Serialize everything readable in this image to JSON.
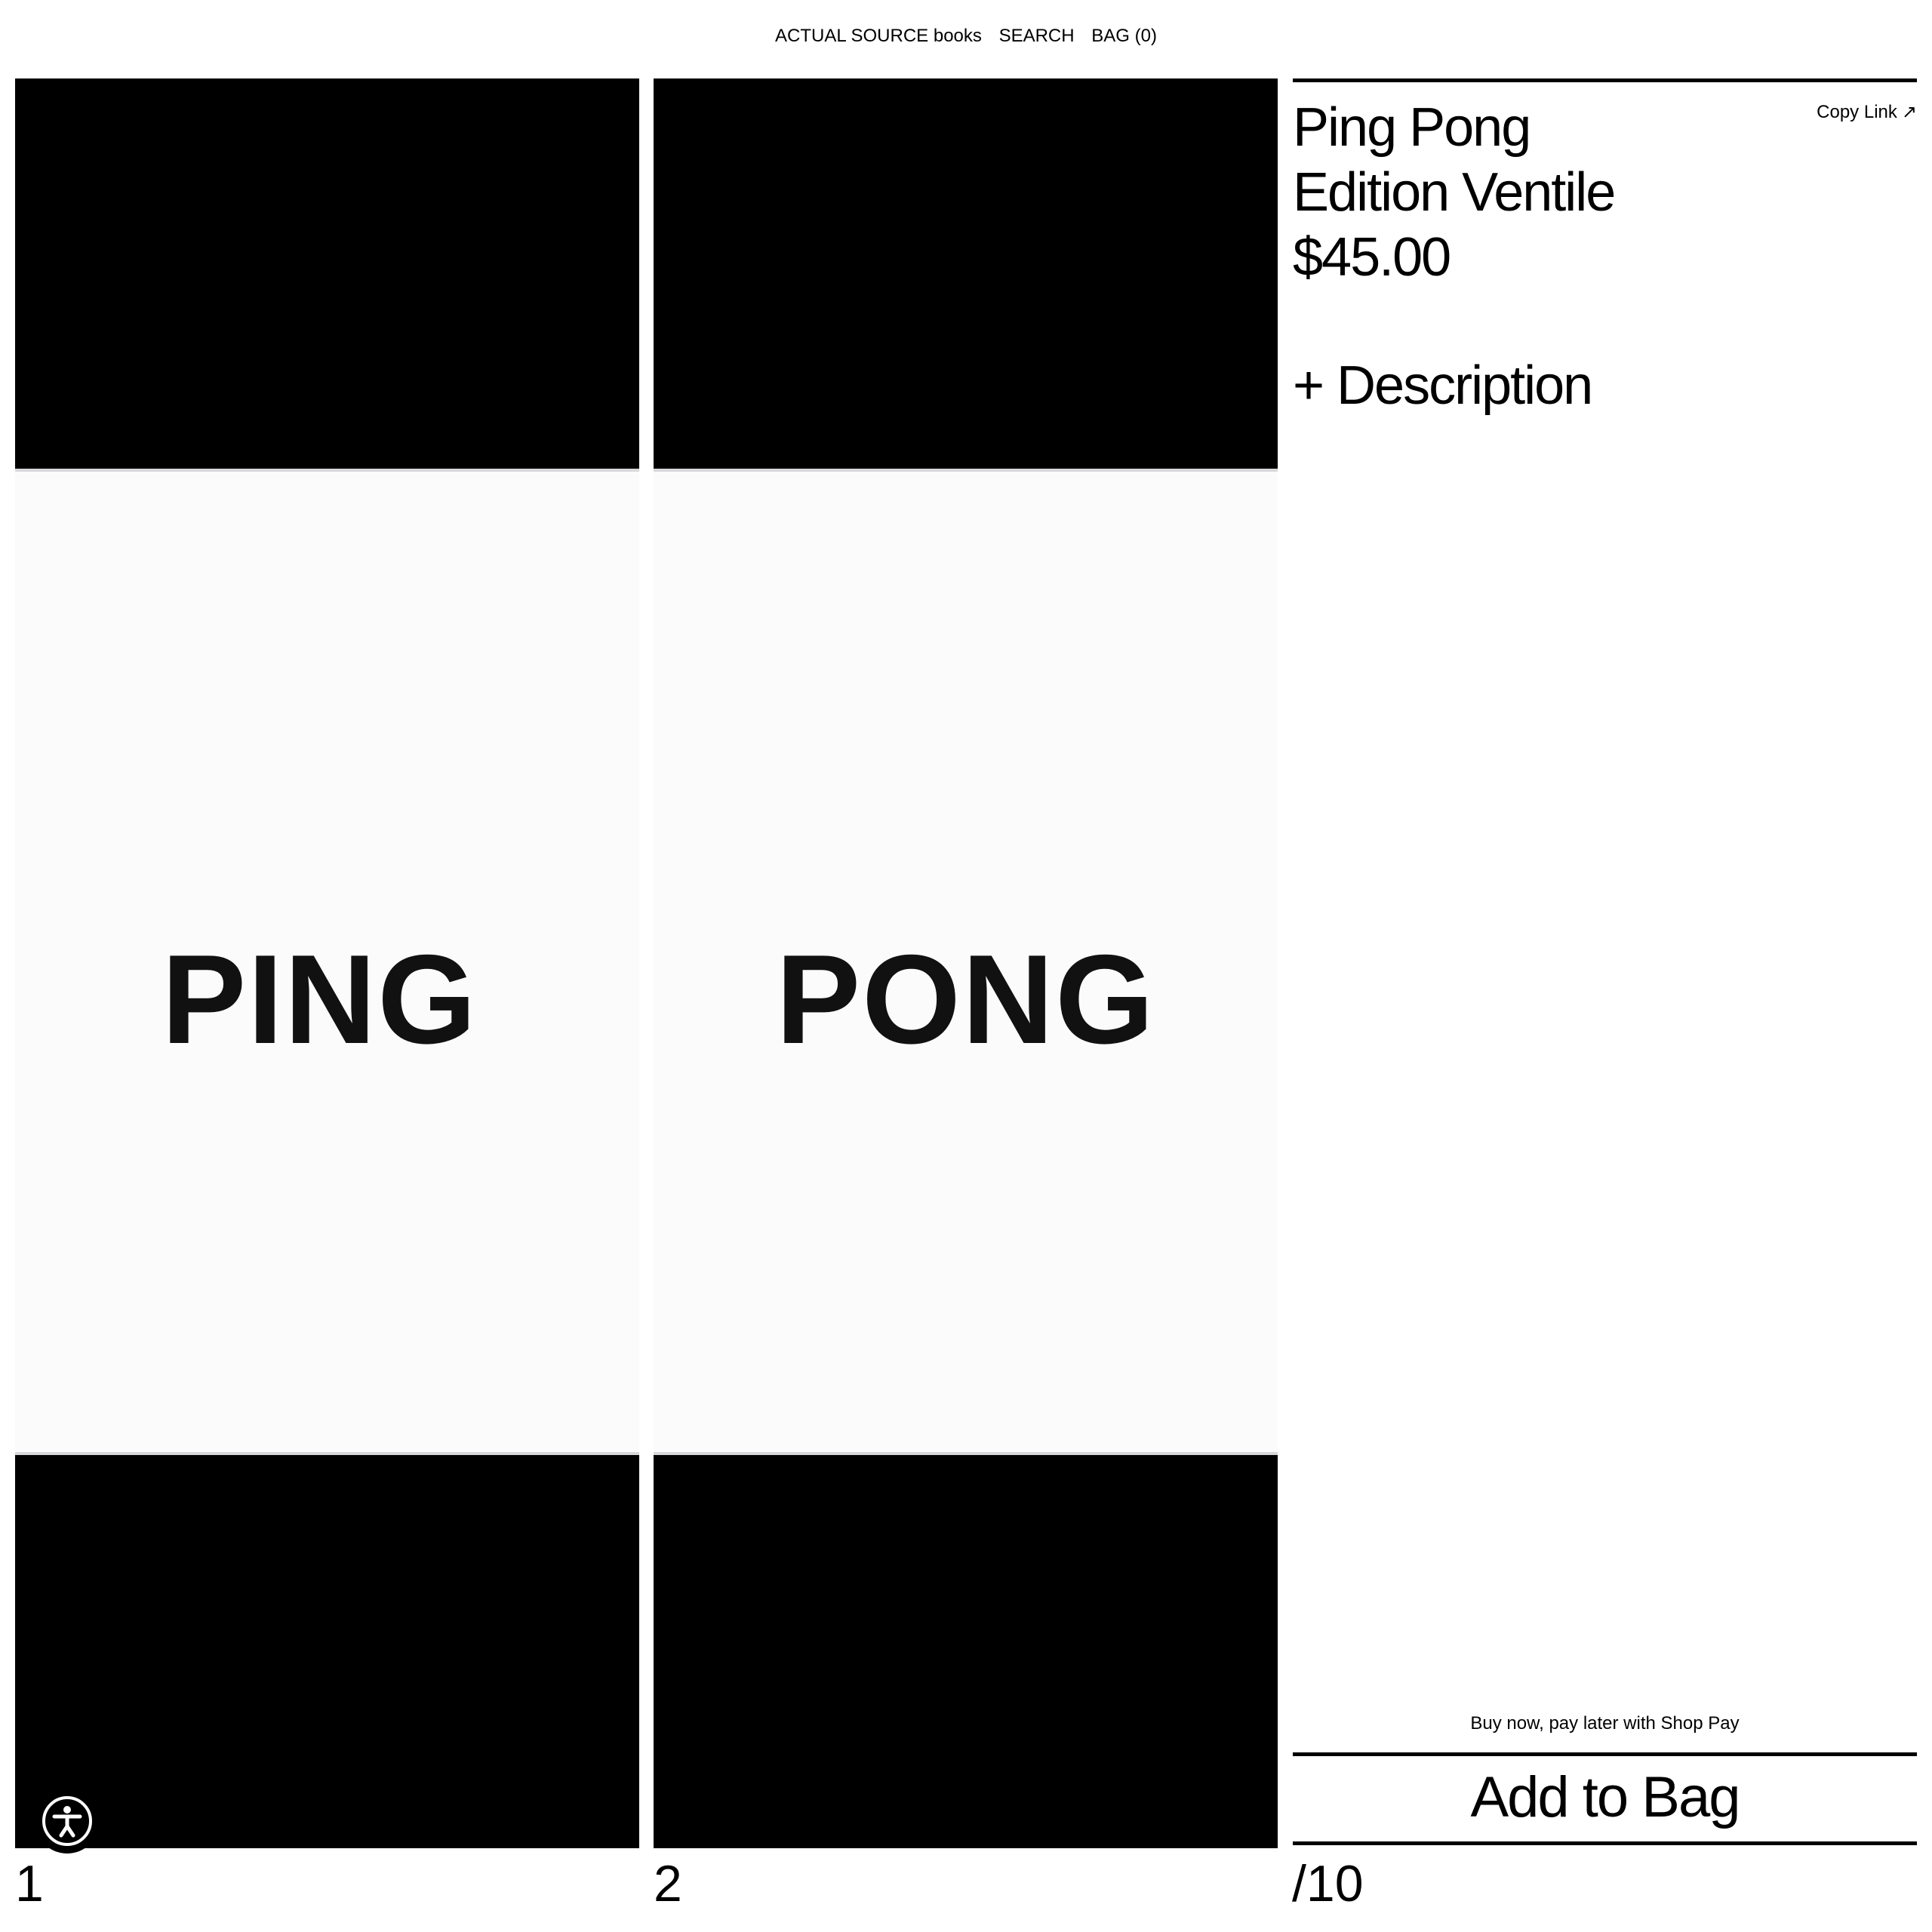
{
  "nav": {
    "brand": "ACTUAL SOURCE books",
    "search": "SEARCH",
    "bag": "BAG (0)"
  },
  "gallery": {
    "images": [
      {
        "index": "1",
        "cover_text": "PING"
      },
      {
        "index": "2",
        "cover_text": "PONG"
      }
    ],
    "total": "/10"
  },
  "product": {
    "title_line1": "Ping Pong",
    "title_line2": "Edition Ventile",
    "price": "$45.00",
    "copy_link": "Copy Link",
    "copy_link_icon": "arrow-up-right-icon",
    "description_toggle": "+ Description",
    "shop_pay_note": "Buy now, pay later with Shop Pay",
    "add_to_bag": "Add to Bag"
  },
  "accessibility": {
    "icon": "accessibility-icon"
  },
  "colors": {
    "background": "#ffffff",
    "foreground": "#000000",
    "cover_paper": "#fbfbfc"
  }
}
